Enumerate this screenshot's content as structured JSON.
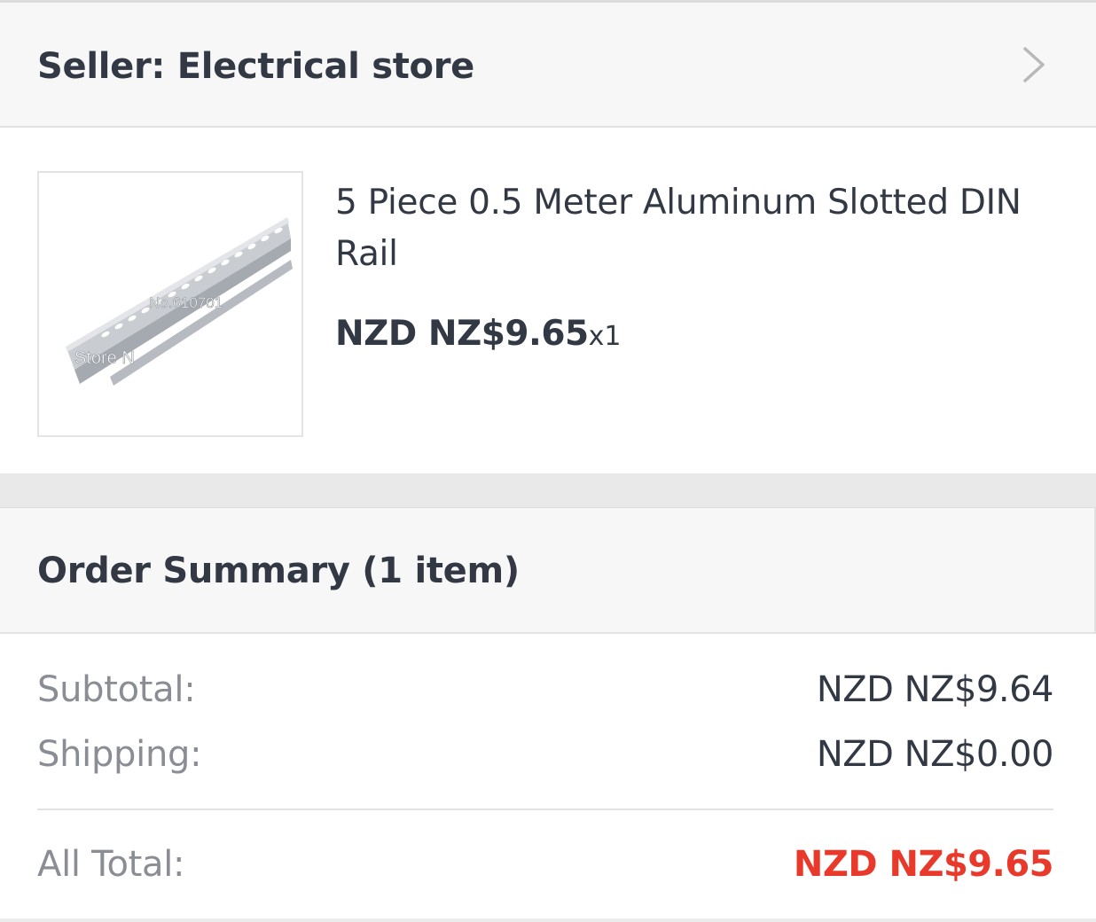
{
  "seller": {
    "label": "Seller: Electrical store"
  },
  "product": {
    "title": "5 Piece 0.5 Meter Aluminum Slotted DIN Rail",
    "price": "NZD NZ$9.65",
    "quantity": "x1",
    "image_watermarks": [
      "No.610701",
      "Store N"
    ]
  },
  "order_summary": {
    "title": "Order Summary (1 item)",
    "subtotal_label": "Subtotal:",
    "subtotal_value": "NZD NZ$9.64",
    "shipping_label": "Shipping:",
    "shipping_value": "NZD NZ$0.00",
    "total_label": "All Total:",
    "total_value": "NZD NZ$9.65"
  },
  "colors": {
    "text": "#333944",
    "muted": "#8a8d93",
    "total_accent": "#e8392b",
    "header_bg": "#f7f7f7"
  },
  "icons": {
    "seller_chevron": "chevron-right-icon"
  }
}
